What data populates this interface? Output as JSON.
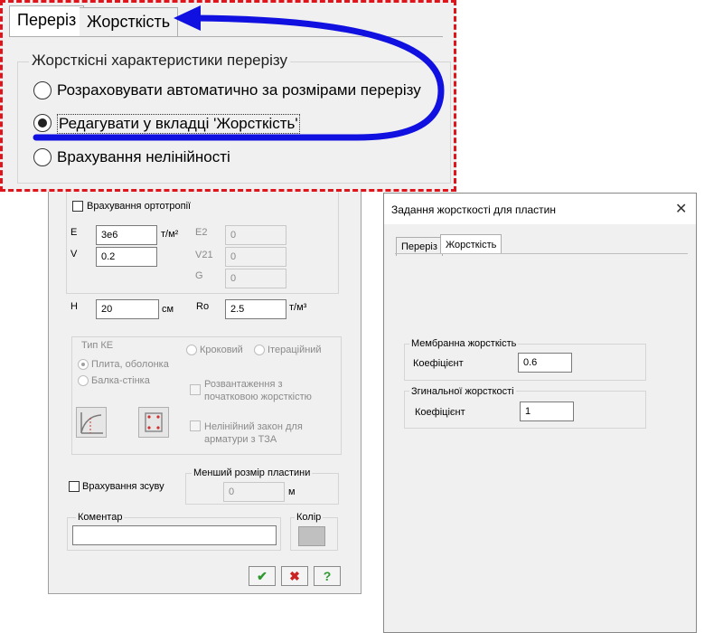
{
  "callout": {
    "tabs": [
      "Переріз",
      "Жорсткість"
    ],
    "group_title": "Жорсткісні характеристики перерізу",
    "options": [
      {
        "label": "Розраховувати автоматично за розмірами перерізу",
        "selected": false
      },
      {
        "label": "Редагувати у вкладці 'Жорсткість'",
        "selected": true
      },
      {
        "label": "Врахування нелінійності",
        "selected": false
      }
    ],
    "border_color": "#e0141b",
    "arrow_color": "#1010e0"
  },
  "left": {
    "orthotropy_label": "Врахування ортотропії",
    "E_label": "E",
    "E_value": "3e6",
    "E_unit": "т/м²",
    "V_label": "V",
    "V_value": "0.2",
    "E2_label": "E2",
    "E2_value": "0",
    "V21_label": "V21",
    "V21_value": "0",
    "G_label": "G",
    "G_value": "0",
    "H_label": "H",
    "H_value": "20",
    "H_unit": "см",
    "Ro_label": "Ro",
    "Ro_value": "2.5",
    "Ro_unit": "т/м³",
    "fe_type_title": "Тип КЕ",
    "fe_plate": "Плита, оболонка",
    "fe_beam": "Балка-стінка",
    "method_step": "Кроковий",
    "method_iter": "Ітераційний",
    "unload_label": "Розвантаження з початковою жорсткістю",
    "nonlinear_law": "Нелінійний закон для арматури з ТЗА",
    "shear_label": "Врахування зсуву",
    "min_size_title": "Менший розмір пластини",
    "min_size_value": "0",
    "min_size_unit": "м",
    "comment_title": "Коментар",
    "comment_value": "",
    "color_title": "Колір",
    "ok_glyph": "✔",
    "cancel_glyph": "✖",
    "help_glyph": "?"
  },
  "right": {
    "title": "Задання жорсткості для пластин",
    "close_glyph": "✕",
    "tabs": [
      "Переріз",
      "Жорсткість"
    ],
    "membrane_title": "Мембранна жорсткість",
    "membrane_coef_label": "Коефіцієнт",
    "membrane_coef_value": "0.6",
    "bending_title": "Згинальної жорсткості",
    "bending_coef_label": "Коефіцієнт",
    "bending_coef_value": "1"
  }
}
